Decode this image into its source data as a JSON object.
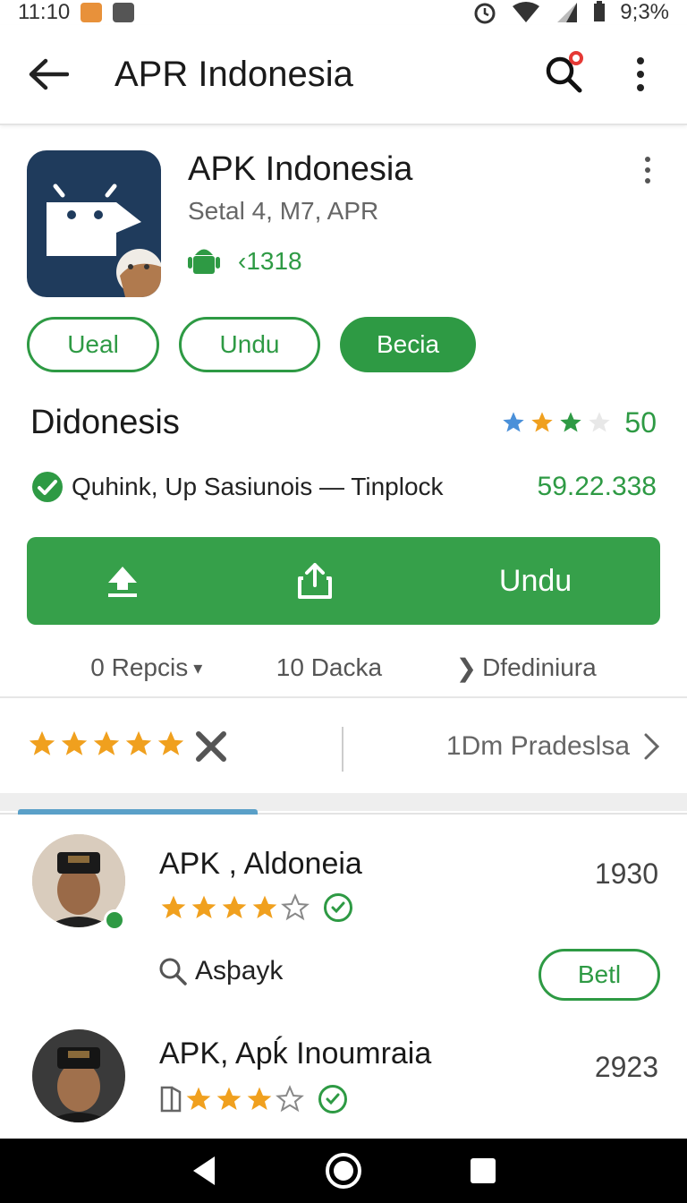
{
  "status_bar": {
    "time": "11:10",
    "battery": "9;3%"
  },
  "toolbar": {
    "title": "APR  Indonesia"
  },
  "app": {
    "name": "APK Indonesia",
    "subtitle": "Setal 4, M7, APR",
    "meta_value": "‹1318"
  },
  "chips": [
    {
      "label": "Ueal",
      "filled": false
    },
    {
      "label": "Undu",
      "filled": false
    },
    {
      "label": "Becia",
      "filled": true
    }
  ],
  "section": {
    "title": "Didonesis",
    "rating_value": "50",
    "rating_stars": 3
  },
  "info": {
    "text": "Quhink, Up Sasiunois — Tinplock",
    "count": "59.22.338"
  },
  "action_bar": {
    "install_label": "Undu"
  },
  "stats": [
    {
      "label": "0 Repcis",
      "suffix": "▾"
    },
    {
      "label": "10 Dacka"
    },
    {
      "label": "Dfediniura",
      "prefix": "❯"
    }
  ],
  "rating_section": {
    "stars": 5,
    "link_label": "1Dm Pradeslsa"
  },
  "reviews": [
    {
      "name": "APK , Aldoneia",
      "count": "1930",
      "stars": 4,
      "search_label": "Asþayk",
      "button_label": "Betl"
    },
    {
      "name": "APK, Apḱ Inoumraia",
      "count": "2923",
      "stars": 4
    }
  ],
  "colors": {
    "accent": "#2e9a44",
    "star": "#f0a01e",
    "star_blue": "#4a90d9",
    "app_icon_bg": "#1f3b5c"
  }
}
